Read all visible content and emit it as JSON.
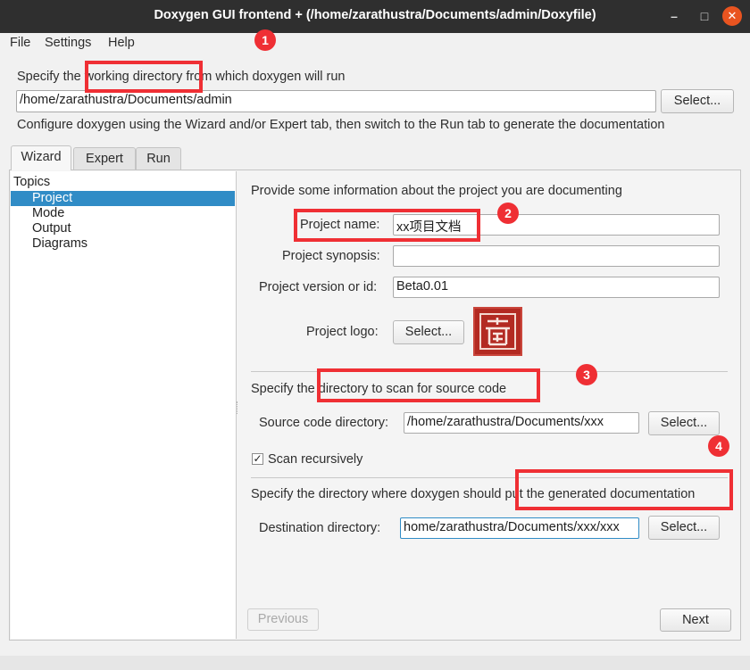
{
  "window": {
    "title": "Doxygen GUI frontend + (/home/zarathustra/Documents/admin/Doxyfile)",
    "controls": {
      "minimize": "–",
      "maximize": "□",
      "close": "✕"
    }
  },
  "menu": {
    "items": [
      "File",
      "Settings",
      "Help"
    ]
  },
  "workdir": {
    "prompt": "Specify the working directory from which doxygen will run",
    "value": "/home/zarathustra/Documents/admin",
    "select_label": "Select...",
    "hint": "Configure doxygen using the Wizard and/or Expert tab, then switch to the Run tab to generate the documentation"
  },
  "tabs": [
    {
      "label": "Wizard",
      "active": true
    },
    {
      "label": "Expert",
      "active": false
    },
    {
      "label": "Run",
      "active": false
    }
  ],
  "topics": {
    "header": "Topics",
    "items": [
      {
        "label": "Project",
        "selected": true
      },
      {
        "label": "Mode",
        "selected": false
      },
      {
        "label": "Output",
        "selected": false
      },
      {
        "label": "Diagrams",
        "selected": false
      }
    ]
  },
  "project": {
    "intro": "Provide some information about the project you are documenting",
    "name_label": "Project name:",
    "name_value": "xx项目文档",
    "synopsis_label": "Project synopsis:",
    "synopsis_value": "",
    "version_label": "Project version or id:",
    "version_value": "Beta0.01",
    "logo_label": "Project logo:",
    "logo_select_label": "Select..."
  },
  "source": {
    "heading": "Specify the directory to scan for source code",
    "dir_label": "Source code directory:",
    "dir_value": "/home/zarathustra/Documents/xxx",
    "select_label": "Select...",
    "recursive_label": "Scan recursively",
    "recursive_checked": true,
    "check_mark": "✓"
  },
  "destination": {
    "heading": "Specify the directory where doxygen should put the generated documentation",
    "dir_label": "Destination directory:",
    "dir_value": "home/zarathustra/Documents/xxx/xxx",
    "select_label": "Select..."
  },
  "nav": {
    "previous_label": "Previous",
    "next_label": "Next"
  },
  "annotations": {
    "badges": [
      "1",
      "2",
      "3",
      "4"
    ],
    "highlight_color": "#ef2f34"
  },
  "colors": {
    "selection": "#308cc6",
    "titlebar": "#2f2f2f",
    "close_button": "#e95420"
  }
}
